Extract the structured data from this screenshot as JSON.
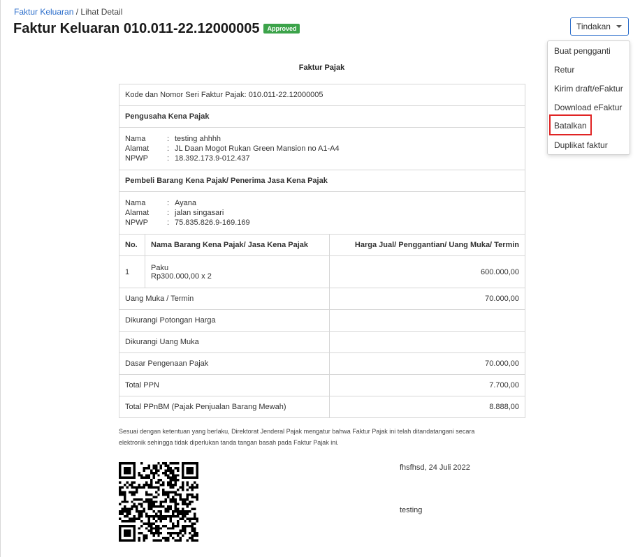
{
  "breadcrumb": {
    "parent": "Faktur Keluaran",
    "separator": " / ",
    "current": "Lihat Detail"
  },
  "header": {
    "title": "Faktur Keluaran 010.011-22.12000005",
    "status": "Approved",
    "status_color": "#3ca34a"
  },
  "actions": {
    "button_label": "Tindakan",
    "menu": [
      "Buat pengganti",
      "Retur",
      "Kirim draft/eFaktur",
      "Download eFaktur",
      "Batalkan",
      "Duplikat faktur"
    ],
    "highlighted_item": "Batalkan",
    "highlight_color": "#e02424"
  },
  "invoice": {
    "heading": "Faktur Pajak",
    "serial_label": "Kode dan Nomor Seri Faktur Pajak: 010.011-22.12000005",
    "seller_heading": "Pengusaha Kena Pajak",
    "seller": {
      "name_label": "Nama",
      "name": "testing ahhhh",
      "address_label": "Alamat",
      "address": "JL Daan Mogot Rukan Green Mansion no A1-A4",
      "npwp_label": "NPWP",
      "npwp": "18.392.173.9-012.437"
    },
    "buyer_heading": "Pembeli Barang Kena Pajak/ Penerima Jasa Kena Pajak",
    "buyer": {
      "name_label": "Nama",
      "name": "Ayana",
      "address_label": "Alamat",
      "address": "jalan singasari",
      "npwp_label": "NPWP",
      "npwp": "75.835.826.9-169.169"
    },
    "columns": {
      "no": "No.",
      "item": "Nama Barang Kena Pajak/ Jasa Kena Pajak",
      "price": "Harga Jual/ Penggantian/ Uang Muka/ Termin"
    },
    "items": [
      {
        "no": "1",
        "name": "Paku",
        "detail": "Rp300.000,00 x 2",
        "amount": "600.000,00"
      }
    ],
    "summary": [
      {
        "label": "Uang Muka / Termin",
        "value": "70.000,00"
      },
      {
        "label": "Dikurangi Potongan Harga",
        "value": ""
      },
      {
        "label": "Dikurangi Uang Muka",
        "value": ""
      },
      {
        "label": "Dasar Pengenaan Pajak",
        "value": "70.000,00"
      },
      {
        "label": "Total PPN",
        "value": "7.700,00"
      },
      {
        "label": "Total PPnBM (Pajak Penjualan Barang Mewah)",
        "value": "8.888,00"
      }
    ],
    "note_line1": "Sesuai dengan ketentuan yang berlaku, Direktorat Jenderal Pajak mengatur bahwa Faktur Pajak ini telah ditandatangani secara",
    "note_line2": "elektronik sehingga tidak diperlukan tanda tangan basah pada Faktur Pajak ini.",
    "place_date": "fhsfhsd, 24 Juli 2022",
    "signer": "testing"
  }
}
